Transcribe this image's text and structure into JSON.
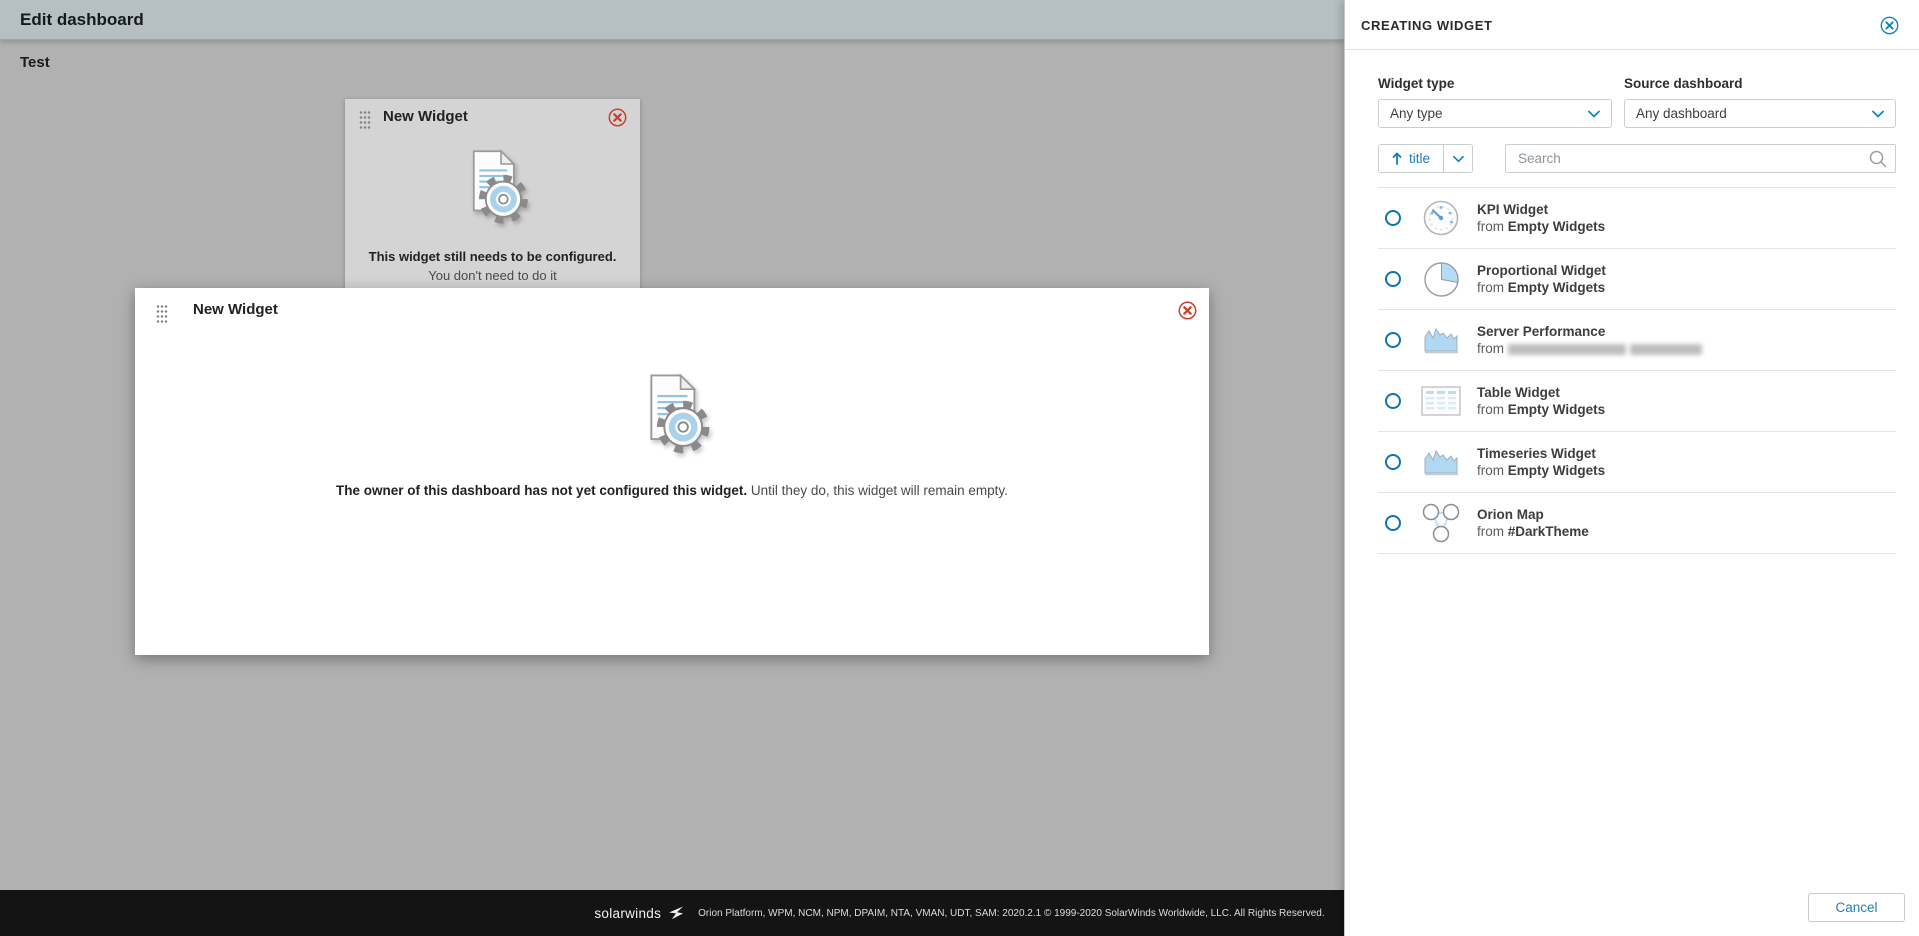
{
  "topbar": {
    "title": "Edit dashboard"
  },
  "canvas": {
    "dashboard_title": "Test",
    "background_widget": {
      "title": "New Widget",
      "message_bold": "This widget still needs to be configured.",
      "message_regular": " You don't need to do it"
    },
    "modal_widget": {
      "title": "New Widget",
      "message_bold": "The owner of this dashboard has not yet configured this widget.",
      "message_regular": " Until they do, this widget will remain empty."
    }
  },
  "panel": {
    "header_title": "CREATING WIDGET",
    "filters": {
      "widget_type_label": "Widget type",
      "widget_type_value": "Any type",
      "source_dashboard_label": "Source dashboard",
      "source_dashboard_value": "Any dashboard"
    },
    "sort": {
      "label": "title",
      "direction": "ascending"
    },
    "search": {
      "placeholder": "Search"
    },
    "from_label": "from",
    "widgets": [
      {
        "title": "KPI Widget",
        "source": "Empty Widgets",
        "icon": "gauge",
        "source_redacted": false
      },
      {
        "title": "Proportional Widget",
        "source": "Empty Widgets",
        "icon": "pie",
        "source_redacted": false
      },
      {
        "title": "Server Performance",
        "source": "",
        "icon": "area",
        "source_redacted": true
      },
      {
        "title": "Table Widget",
        "source": "Empty Widgets",
        "icon": "table",
        "source_redacted": false
      },
      {
        "title": "Timeseries Widget",
        "source": "Empty Widgets",
        "icon": "area",
        "source_redacted": false
      },
      {
        "title": "Orion Map",
        "source": "#DarkTheme",
        "icon": "map",
        "source_redacted": false
      }
    ],
    "cancel_label": "Cancel"
  },
  "footer": {
    "logo_text": "solarwinds",
    "copyright": "Orion Platform, WPM, NCM, NPM, DPAIM, NTA, VMAN, UDT, SAM: 2020.2.1 © 1999-2020 SolarWinds Worldwide, LLC. All Rights Reserved."
  },
  "colors": {
    "topbar_bg": "#b6c0c4",
    "page_bg": "#b1b1b1",
    "card_bg": "#d4d4d4",
    "accent_blue": "#0d7fb8",
    "icon_blue": "#aed7f0",
    "close_red": "#c9402e",
    "footer_bg": "#141414"
  }
}
